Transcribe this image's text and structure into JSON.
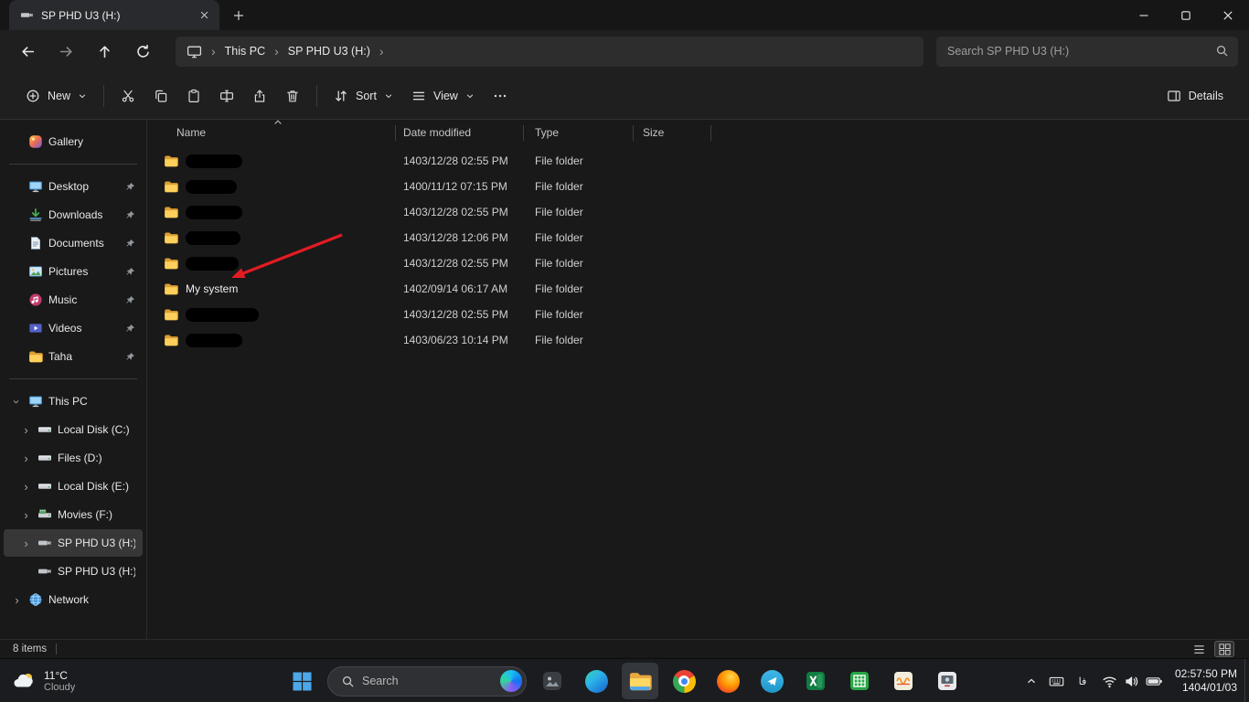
{
  "window": {
    "tab": {
      "title": "SP PHD U3 (H:)"
    },
    "breadcrumb": [
      "This PC",
      "SP PHD U3 (H:)"
    ],
    "search_placeholder": "Search SP PHD U3 (H:)"
  },
  "commandbar": {
    "new": "New",
    "sort": "Sort",
    "view": "View",
    "details": "Details"
  },
  "sidebar": {
    "items": [
      {
        "label": "Gallery",
        "icon": "gallery",
        "pinned": false,
        "chev": "",
        "divider_after": true
      },
      {
        "label": "Desktop",
        "icon": "desktop",
        "pinned": true,
        "chev": ""
      },
      {
        "label": "Downloads",
        "icon": "downloads",
        "pinned": true,
        "chev": ""
      },
      {
        "label": "Documents",
        "icon": "documents",
        "pinned": true,
        "chev": ""
      },
      {
        "label": "Pictures",
        "icon": "pictures",
        "pinned": true,
        "chev": ""
      },
      {
        "label": "Music",
        "icon": "music",
        "pinned": true,
        "chev": ""
      },
      {
        "label": "Videos",
        "icon": "videos",
        "pinned": true,
        "chev": ""
      },
      {
        "label": "Taha",
        "icon": "folder",
        "pinned": true,
        "chev": "",
        "divider_after": true
      },
      {
        "label": "This PC",
        "icon": "thispc",
        "chev": "down"
      },
      {
        "label": "Local Disk (C:)",
        "icon": "drive",
        "chev": "right",
        "indent": true
      },
      {
        "label": "Files (D:)",
        "icon": "drive",
        "chev": "right",
        "indent": true
      },
      {
        "label": "Local Disk (E:)",
        "icon": "drive",
        "chev": "right",
        "indent": true
      },
      {
        "label": "Movies (F:)",
        "icon": "drive-media",
        "chev": "right",
        "indent": true
      },
      {
        "label": "SP PHD U3 (H:)",
        "icon": "usb",
        "chev": "right",
        "indent": true,
        "selected": true
      },
      {
        "label": "SP PHD U3 (H:)",
        "icon": "usb",
        "chev": "",
        "indent": true
      },
      {
        "label": "Network",
        "icon": "network",
        "chev": "right"
      }
    ]
  },
  "filelist": {
    "columns": {
      "name": "Name",
      "date": "Date modified",
      "type": "Type",
      "size": "Size"
    },
    "rows": [
      {
        "name": "",
        "redacted": true,
        "date": "1403/12/28 02:55 PM",
        "type": "File folder",
        "size": ""
      },
      {
        "name": "",
        "redacted": true,
        "date": "1400/11/12 07:15 PM",
        "type": "File folder",
        "size": ""
      },
      {
        "name": "",
        "redacted": true,
        "date": "1403/12/28 02:55 PM",
        "type": "File folder",
        "size": ""
      },
      {
        "name": "",
        "redacted": true,
        "date": "1403/12/28 12:06 PM",
        "type": "File folder",
        "size": ""
      },
      {
        "name": "",
        "redacted": true,
        "date": "1403/12/28 02:55 PM",
        "type": "File folder",
        "size": ""
      },
      {
        "name": "My system",
        "redacted": false,
        "date": "1402/09/14 06:17 AM",
        "type": "File folder",
        "size": ""
      },
      {
        "name": "",
        "redacted": true,
        "date": "1403/12/28 02:55 PM",
        "type": "File folder",
        "size": ""
      },
      {
        "name": "",
        "redacted": true,
        "date": "1403/06/23 10:14 PM",
        "type": "File folder",
        "size": ""
      }
    ]
  },
  "statusbar": {
    "count": "8 items"
  },
  "taskbar": {
    "weather": {
      "temp": "11°C",
      "condition": "Cloudy"
    },
    "search": "Search",
    "language": "فا",
    "clock": {
      "time": "02:57:50 PM",
      "date": "1404/01/03"
    }
  }
}
